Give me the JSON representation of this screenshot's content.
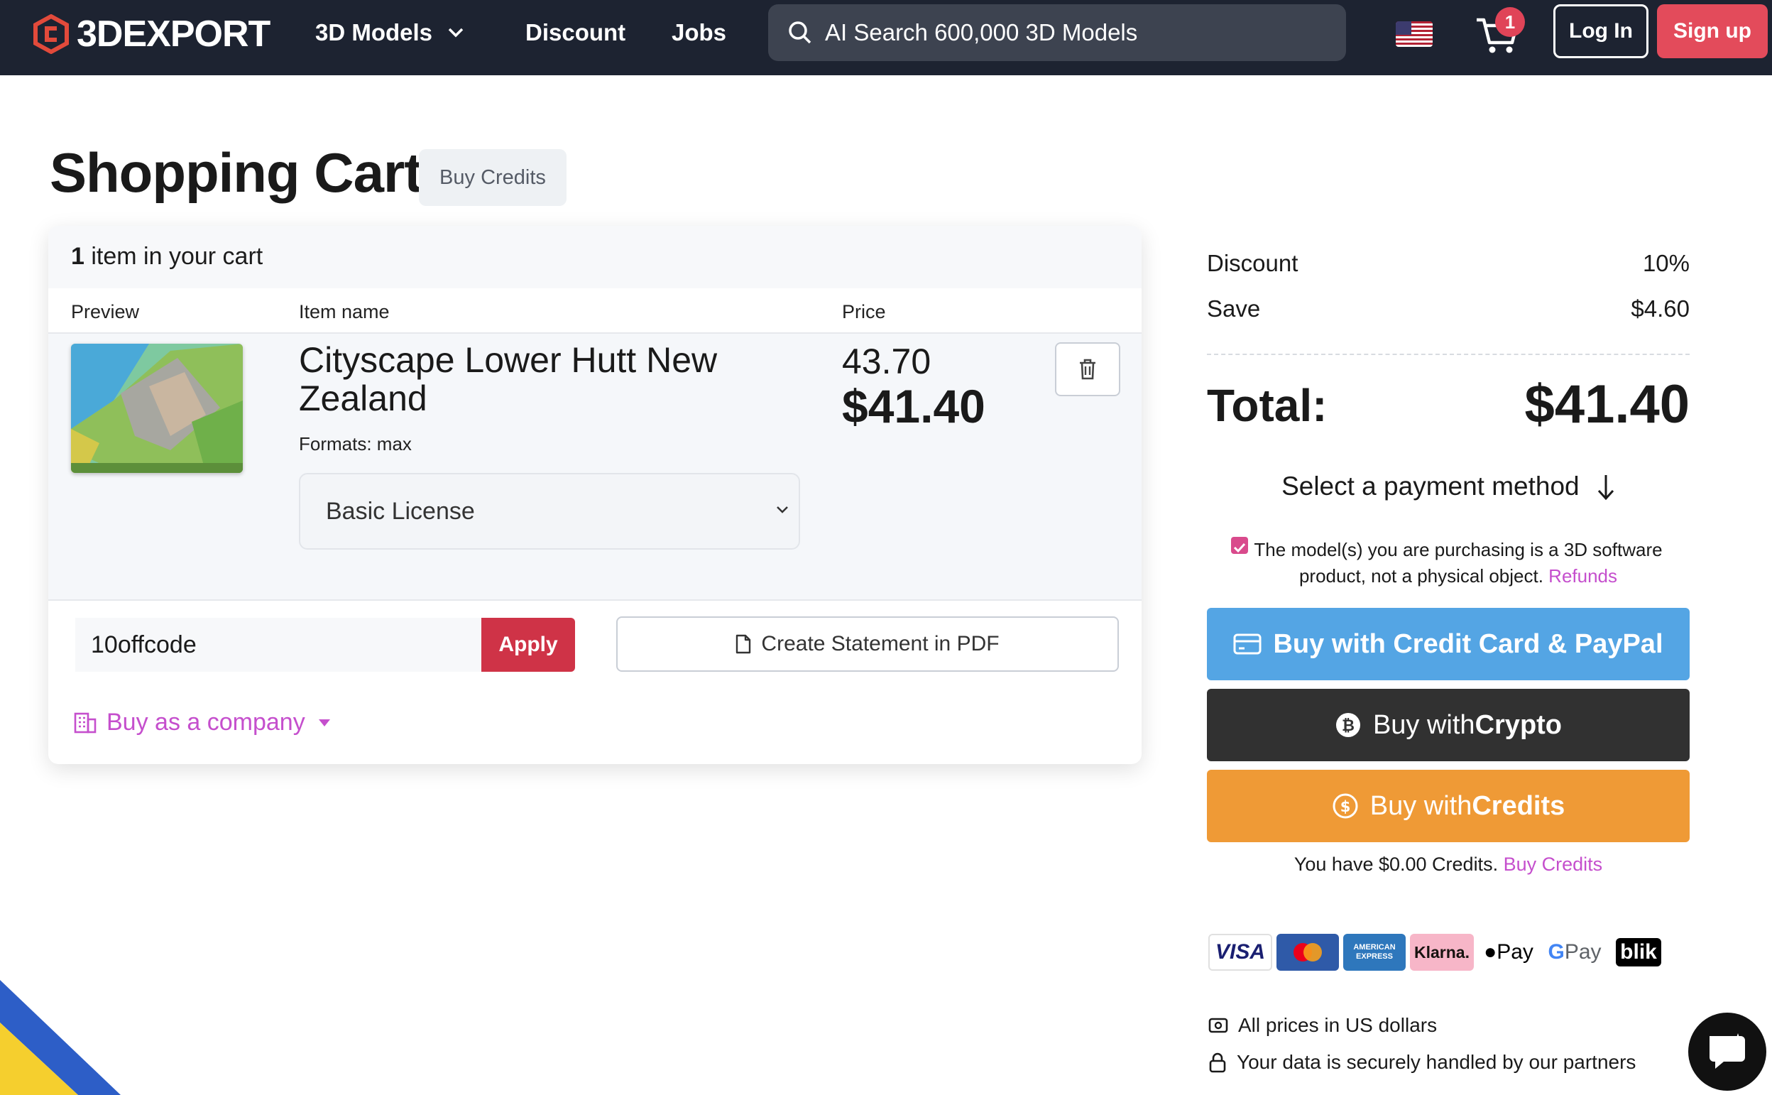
{
  "header": {
    "logo_text": "3DEXPORT",
    "nav": [
      {
        "label": "3D Models"
      },
      {
        "label": "Discount"
      },
      {
        "label": "Jobs"
      }
    ],
    "search_placeholder": "AI Search 600,000 3D Models",
    "cart_count": "1",
    "login_label": "Log In",
    "signup_label": "Sign up"
  },
  "page": {
    "title": "Shopping Cart",
    "buy_credits_label": "Buy Credits"
  },
  "cart": {
    "count": "1",
    "count_suffix": " item in your cart",
    "columns": [
      "Preview",
      "Item name",
      "Price"
    ],
    "item": {
      "name": "Cityscape Lower Hutt New Zealand",
      "formats": "Formats: max",
      "license": "Basic License",
      "price_original": "43.70",
      "price_final": "$41.40"
    },
    "coupon_value": "10offcode",
    "apply_label": "Apply",
    "pdf_label": "Create Statement in PDF",
    "company_label": "Buy as a company"
  },
  "summary": {
    "discount_label": "Discount",
    "discount_value": "10%",
    "save_label": "Save",
    "save_value": "$4.60",
    "total_label": "Total:",
    "total_value": "$41.40",
    "select_payment": "Select a payment method",
    "consent_text": "The model(s) you are purchasing is a 3D software product, not a physical object. ",
    "refunds_label": "Refunds",
    "buttons": {
      "card": "Buy with Credit Card & PayPal",
      "crypto_prefix": "Buy with ",
      "crypto_bold": "Crypto",
      "credits_prefix": "Buy with ",
      "credits_bold": "Credits"
    },
    "credits_note": "You have $0.00 Credits. ",
    "credits_link": "Buy Credits",
    "payment_logos": [
      "VISA",
      "Mastercard",
      "AMERICAN EXPRESS",
      "Klarna.",
      "Pay",
      "Pay",
      "blik"
    ],
    "info": [
      "All prices in US dollars",
      "Your data is securely handled by our partners"
    ]
  },
  "colors": {
    "header_bg": "#1d2331",
    "signup": "#e34b5b",
    "apply": "#cf3347",
    "accent_purple": "#c54fcd",
    "pay_card": "#54a5e4",
    "pay_crypto": "#313131",
    "pay_credits": "#ef9a36"
  },
  "icons": [
    "logo-icon",
    "chevron-down-icon",
    "search-icon",
    "us-flag-icon",
    "cart-icon",
    "trash-icon",
    "document-icon",
    "building-icon",
    "caret-down-icon",
    "arrow-down-icon",
    "checkbox-icon",
    "credit-card-icon",
    "bitcoin-icon",
    "dollar-coin-icon",
    "money-icon",
    "lock-icon",
    "chat-icon"
  ]
}
